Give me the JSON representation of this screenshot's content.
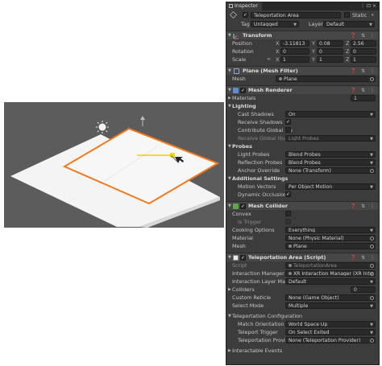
{
  "inspector": {
    "tab_label": "Inspector",
    "object_name": "Teleportation Area",
    "static_label": "Static",
    "tag_label": "Tag",
    "tag_value": "Untagged",
    "layer_label": "Layer",
    "layer_value": "Default"
  },
  "transform": {
    "title": "Transform",
    "position_label": "Position",
    "position": {
      "x": "-3.11813",
      "y": "0.08",
      "z": "2.56"
    },
    "rotation_label": "Rotation",
    "rotation": {
      "x": "0",
      "y": "0",
      "z": "0"
    },
    "scale_label": "Scale",
    "scale": {
      "x": "1",
      "y": "1",
      "z": "1"
    }
  },
  "mesh_filter": {
    "title": "Plane (Mesh Filter)",
    "mesh_label": "Mesh",
    "mesh_value": "Plane"
  },
  "mesh_renderer": {
    "title": "Mesh Renderer",
    "materials_label": "Materials",
    "materials_count": "1",
    "lighting_label": "Lighting",
    "cast_shadows_label": "Cast Shadows",
    "cast_shadows_value": "On",
    "receive_shadows_label": "Receive Shadows",
    "contribute_gi_label": "Contribute Global Illu",
    "receive_gi_label": "Receive Global Illum",
    "receive_gi_value": "Light Probes",
    "probes_label": "Probes",
    "light_probes_label": "Light Probes",
    "light_probes_value": "Blend Probes",
    "reflection_probes_label": "Reflection Probes",
    "reflection_probes_value": "Blend Probes",
    "anchor_override_label": "Anchor Override",
    "anchor_override_value": "None (Transform)",
    "additional_label": "Additional Settings",
    "motion_vectors_label": "Motion Vectors",
    "motion_vectors_value": "Per Object Motion",
    "dynamic_occlusion_label": "Dynamic Occlusion"
  },
  "mesh_collider": {
    "title": "Mesh Collider",
    "convex_label": "Convex",
    "is_trigger_label": "Is Trigger",
    "cooking_label": "Cooking Options",
    "cooking_value": "Everything",
    "material_label": "Material",
    "material_value": "None (Physic Material)",
    "mesh_label": "Mesh",
    "mesh_value": "Plane"
  },
  "teleport": {
    "title": "Teleportation Area (Script)",
    "script_label": "Script",
    "script_value": "TeleportationArea",
    "interaction_manager_label": "Interaction Manager",
    "interaction_manager_value": "XR Interaction Manager (XR Inte",
    "interaction_layer_label": "Interaction Layer Mask",
    "interaction_layer_value": "Default",
    "colliders_label": "Colliders",
    "colliders_count": "0",
    "custom_reticle_label": "Custom Reticle",
    "custom_reticle_value": "None (Game Object)",
    "select_mode_label": "Select Mode",
    "select_mode_value": "Multiple",
    "config_label": "Teleportation Configuration",
    "match_orientation_label": "Match Orientation",
    "match_orientation_value": "World Space Up",
    "teleport_trigger_label": "Teleport Trigger",
    "teleport_trigger_value": "On Select Exited",
    "teleport_provider_label": "Teleportation Provide",
    "teleport_provider_value": "None (Teleportation Provider)",
    "events_label": "Interactable Events"
  },
  "icons": {
    "gameobject": "cube-icon",
    "transform": "transform-axes-icon",
    "mesh_filter": "mesh-filter-icon",
    "mesh_renderer": "mesh-renderer-icon",
    "mesh_collider": "mesh-collider-icon",
    "script": "script-icon"
  },
  "colors": {
    "selection_outline": "#f07a1f",
    "inspector_bg": "#3c3c3c",
    "scene_bg": "#5c5c5c",
    "script_icon": "#5aa848",
    "renderer_icon": "#5a8ed0"
  }
}
